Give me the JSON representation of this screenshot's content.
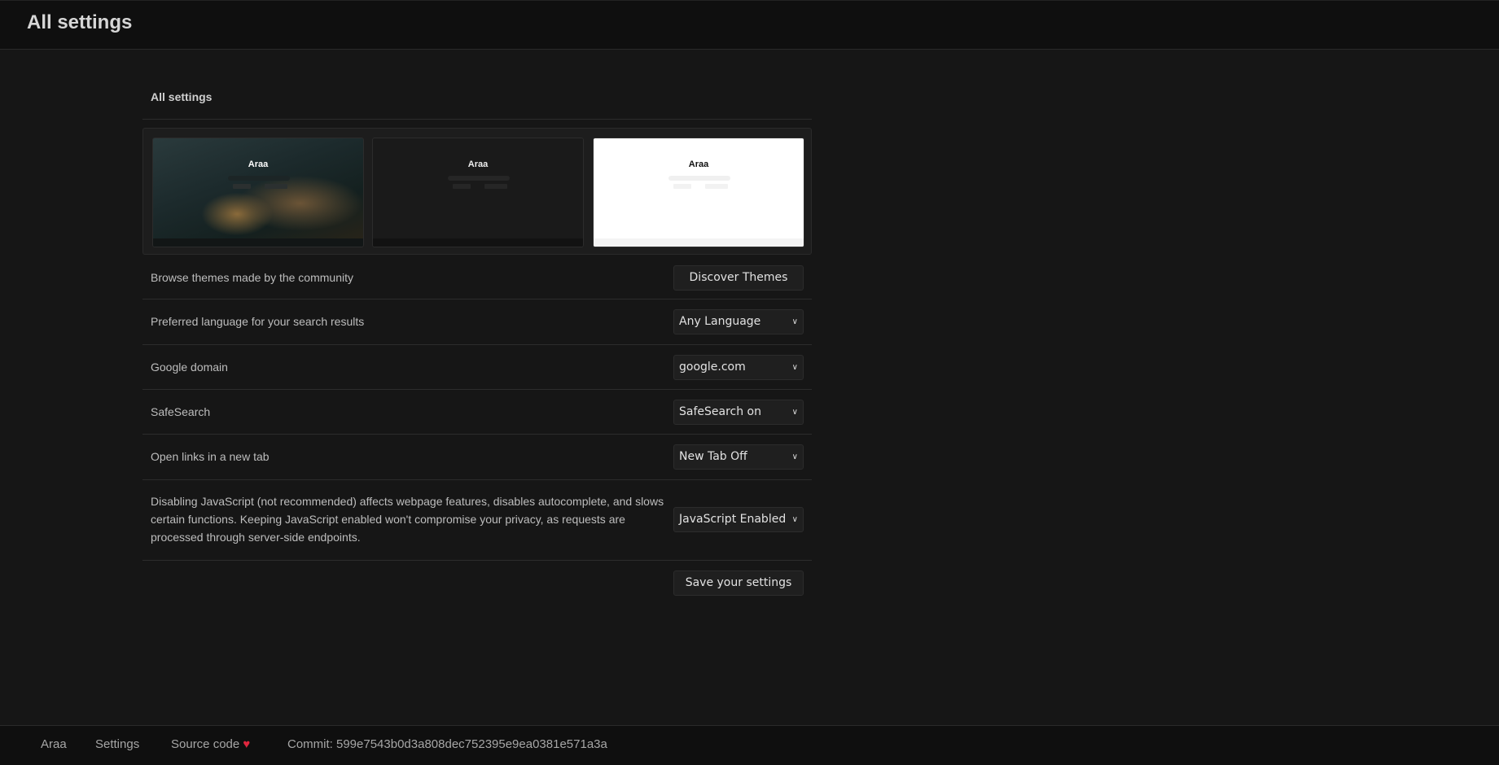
{
  "header": {
    "title": "All settings"
  },
  "section": {
    "title": "All settings"
  },
  "themes": [
    {
      "name": "background-image-theme",
      "logo": "Araa"
    },
    {
      "name": "dark-theme",
      "logo": "Araa"
    },
    {
      "name": "light-theme",
      "logo": "Araa"
    }
  ],
  "settings": [
    {
      "label": "Browse themes made by the community",
      "type": "button",
      "value": "Discover Themes"
    },
    {
      "label": "Preferred language for your search results",
      "type": "select",
      "value": "Any Language"
    },
    {
      "label": "Google domain",
      "type": "select",
      "value": "google.com"
    },
    {
      "label": "SafeSearch",
      "type": "select",
      "value": "SafeSearch on"
    },
    {
      "label": "Open links in a new tab",
      "type": "select",
      "value": "New Tab Off"
    },
    {
      "label": "Disabling JavaScript (not recommended) affects webpage features, disables autocomplete, and slows certain functions. Keeping JavaScript enabled won't compromise your privacy, as requests are processed through server-side endpoints.",
      "type": "select",
      "value": "JavaScript Enabled"
    }
  ],
  "save_label": "Save your settings",
  "footer": {
    "home": "Araa",
    "settings": "Settings",
    "source": "Source code",
    "heart": "♥",
    "commit": "Commit: 599e7543b0d3a808dec752395e9ea0381e571a3a"
  },
  "colors": {
    "background": "#161616",
    "header": "#0f0f0f",
    "heart": "#e0263e"
  }
}
